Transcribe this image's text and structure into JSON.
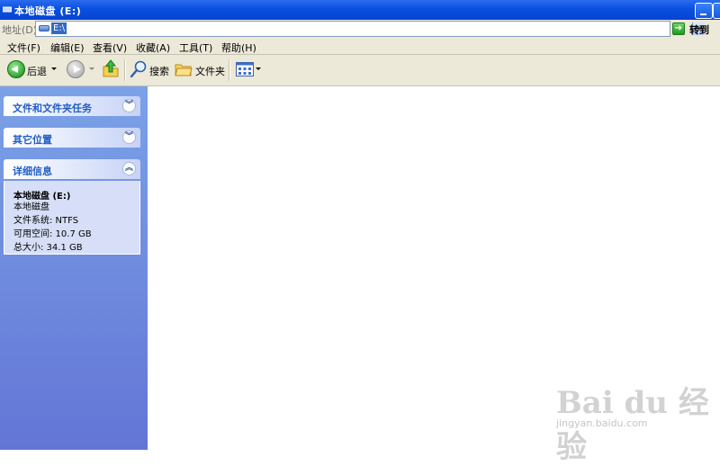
{
  "window": {
    "title": "本地磁盘 (E:)"
  },
  "address": {
    "label": "地址(D)",
    "value": "E:\\",
    "go_label": "转到"
  },
  "menu": [
    "文件(F)",
    "编辑(E)",
    "查看(V)",
    "收藏(A)",
    "工具(T)",
    "帮助(H)"
  ],
  "toolbar": {
    "back_label": "后退",
    "search_label": "搜索",
    "folders_label": "文件夹"
  },
  "taskpane": {
    "panels": [
      {
        "title": "文件和文件夹任务",
        "toggle": "expand"
      },
      {
        "title": "其它位置",
        "toggle": "expand"
      },
      {
        "title": "详细信息",
        "toggle": "collapse"
      }
    ],
    "details": {
      "name": "本地磁盘 (E:)",
      "type": "本地磁盘",
      "filesystem": "文件系统: NTFS",
      "free_space": "可用空间: 10.7 GB",
      "total_size": "总大小: 34.1 GB"
    }
  },
  "watermark": {
    "main": "Bai du 经验",
    "sub": "jingyan.baidu.com"
  },
  "colors": {
    "titlebar": "#0a50e0",
    "taskpane": "#7ba2e7",
    "panel_title": "#215dc6",
    "selection": "#316ac5"
  }
}
